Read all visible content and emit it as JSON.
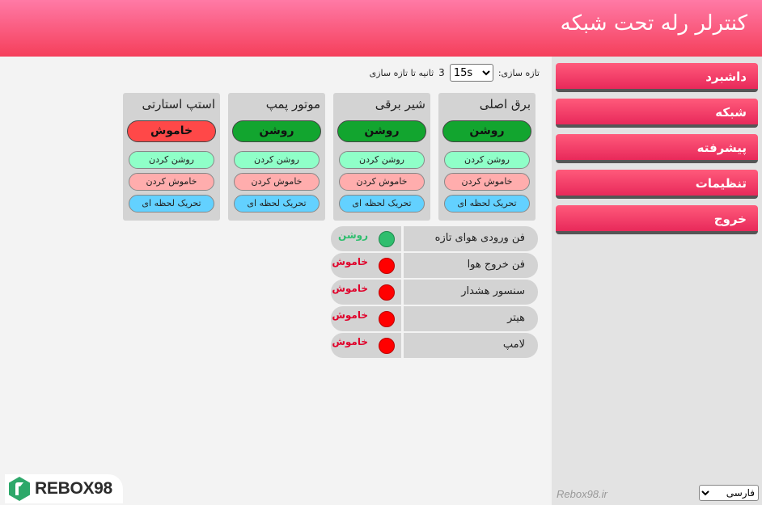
{
  "header": {
    "title": "کنترلر رله تحت شبکه"
  },
  "sidebar": {
    "items": [
      {
        "label": "داشبرد"
      },
      {
        "label": "شبکه"
      },
      {
        "label": "پیشرفته"
      },
      {
        "label": "تنظیمات"
      },
      {
        "label": "خروج"
      }
    ],
    "brand": "Rebox98.ir",
    "language": {
      "selected": "فارسی"
    }
  },
  "refresh": {
    "label": "تازه سازی:",
    "selected": "15s",
    "countdown": "3",
    "suffix": "ثانیه تا تازه سازی"
  },
  "relays": [
    {
      "title": "برق اصلی",
      "status": "روشن",
      "state": "on",
      "on_label": "روشن کردن",
      "off_label": "خاموش کردن",
      "pulse_label": "تحریک لحظه ای"
    },
    {
      "title": "شیر برقی",
      "status": "روشن",
      "state": "on",
      "on_label": "روشن کردن",
      "off_label": "خاموش کردن",
      "pulse_label": "تحریک لحظه ای"
    },
    {
      "title": "موتور پمپ",
      "status": "روشن",
      "state": "on",
      "on_label": "روشن کردن",
      "off_label": "خاموش کردن",
      "pulse_label": "تحریک لحظه ای"
    },
    {
      "title": "استپ استارتی",
      "status": "خاموش",
      "state": "off",
      "on_label": "روشن کردن",
      "off_label": "خاموش کردن",
      "pulse_label": "تحریک لحظه ای"
    }
  ],
  "inputs": [
    {
      "label": "فن ورودی هوای تازه",
      "status": "روشن",
      "state": "on"
    },
    {
      "label": "فن خروج هوا",
      "status": "خاموش",
      "state": "off"
    },
    {
      "label": "سنسور هشدار",
      "status": "خاموش",
      "state": "off"
    },
    {
      "label": "هیتر",
      "status": "خاموش",
      "state": "off"
    },
    {
      "label": "لامپ",
      "status": "خاموش",
      "state": "off"
    }
  ],
  "logo": {
    "text": "REBOX98"
  },
  "colors": {
    "accent": "#f53f5b",
    "on": "#12a52f",
    "off": "#ff4848"
  }
}
